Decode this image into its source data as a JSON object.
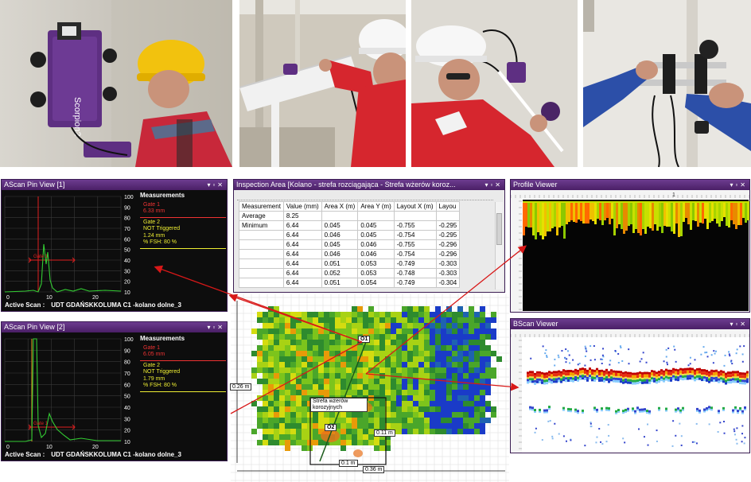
{
  "ascan1": {
    "title": "AScan Pin View [1]",
    "y_ticks": [
      "100",
      "90",
      "80",
      "70",
      "60",
      "50",
      "40",
      "30",
      "20",
      "10"
    ],
    "x_ticks": [
      "0",
      "10",
      "20"
    ],
    "gate_label": "Gate 1",
    "measurements": {
      "heading": "Measurements",
      "gate1": "Gate 1",
      "gate1_value": "6.33 mm",
      "gate2": "Gate 2",
      "gate2_status": "NOT Triggered",
      "gate2_value": "1.24 mm",
      "fsh": "% FSH: 80 %"
    },
    "active_scan_label": "Active Scan :",
    "active_scan_value": "UDT GDAŃSKKOLUMA C1  -kolano dolne_3"
  },
  "ascan2": {
    "title": "AScan Pin View [2]",
    "y_ticks": [
      "100",
      "90",
      "80",
      "70",
      "60",
      "50",
      "40",
      "30",
      "20",
      "10"
    ],
    "x_ticks": [
      "0",
      "10",
      "20"
    ],
    "gate_label": "Gate 1",
    "measurements": {
      "heading": "Measurements",
      "gate1": "Gate 1",
      "gate1_value": "6.05 mm",
      "gate2": "Gate 2",
      "gate2_status": "NOT Triggered",
      "gate2_value": "1.79 mm",
      "fsh": "% FSH: 80 %"
    },
    "active_scan_label": "Active Scan :",
    "active_scan_value": "UDT GDAŃSKKOLUMA C1  -kolano dolne_3"
  },
  "inspection": {
    "title": "Inspection Area [Kolano - strefa rozciągająca - Strefa wżerów koroz...",
    "columns": [
      "Measurement",
      "Value (mm)",
      "Area X (m)",
      "Area Y (m)",
      "Layout X (m)",
      "Layou"
    ],
    "rows": [
      [
        "Average",
        "8.25",
        "",
        "",
        "",
        ""
      ],
      [
        "Minimum",
        "6.44",
        "0.045",
        "0.045",
        "-0.755",
        "-0.295"
      ],
      [
        "",
        "6.44",
        "0.046",
        "0.045",
        "-0.754",
        "-0.295"
      ],
      [
        "",
        "6.44",
        "0.045",
        "0.046",
        "-0.755",
        "-0.296"
      ],
      [
        "",
        "6.44",
        "0.046",
        "0.046",
        "-0.754",
        "-0.296"
      ],
      [
        "",
        "6.44",
        "0.051",
        "0.053",
        "-0.749",
        "-0.303"
      ],
      [
        "",
        "6.44",
        "0.052",
        "0.053",
        "-0.748",
        "-0.303"
      ],
      [
        "",
        "6.44",
        "0.051",
        "0.054",
        "-0.749",
        "-0.304"
      ]
    ]
  },
  "map": {
    "label_o1": "O1",
    "label_o2": "O2",
    "zone_label": "Strefa wżerów korozyjnych",
    "dim_left": "0.26 m",
    "dim_small": "0.11 m",
    "dim_bottom_small": "0.1 m",
    "dim_bottom": "0.36 m"
  },
  "profile": {
    "title": "Profile Viewer",
    "ruler_mark": "1"
  },
  "bscan": {
    "title": "BScan Viewer"
  },
  "photos": [
    {
      "name": "scorpion-robot-photo",
      "device_text": "Scorpion2"
    },
    {
      "name": "pipe-inspection-photo"
    },
    {
      "name": "wall-probe-photo"
    },
    {
      "name": "scanner-frame-photo"
    }
  ],
  "colors": {
    "accent_purple": "#5a2a7a",
    "gate_red": "#e02020",
    "gate_yellow": "#e8e820",
    "signal_green": "#33cc33",
    "arrow_red": "#d81818"
  }
}
